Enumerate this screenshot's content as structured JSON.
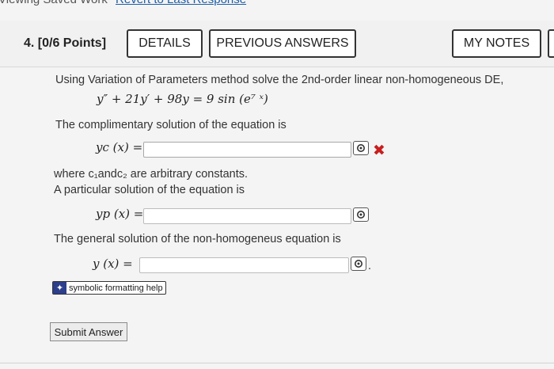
{
  "top_nav": {
    "viewing_text": "Viewing Saved Work",
    "revert_link": "Revert to Last Response"
  },
  "question": {
    "number_label": "4. [0/6 Points]",
    "details_label": "DETAILS",
    "previous_answers_label": "PREVIOUS ANSWERS",
    "my_notes_label": "MY NOTES"
  },
  "problem": {
    "intro": "Using Variation of Parameters method solve the 2nd-order linear non-homogeneous DE,",
    "equation": "y″ + 21y′ + 98y = 9 sin (e⁷ ˣ)",
    "complementary_prompt": "The complimentary solution of the equation is",
    "yc_label": "yc (x) =",
    "yc_value": "",
    "constants_note": "where c₁andc₂ are arbitrary constants.",
    "particular_prompt": "A particular solution of the equation is",
    "yp_label": "yp (x) =",
    "yp_value": "",
    "general_prompt": "The general solution of the non-homogeneus equation is",
    "y_label": "y (x) =",
    "y_value": "",
    "period": "."
  },
  "status": {
    "yc_incorrect": "✖"
  },
  "help": {
    "label": "symbolic formatting help"
  },
  "actions": {
    "submit_label": "Submit Answer"
  },
  "colors": {
    "error": "#c81e1e",
    "help_badge": "#2d3e8c"
  }
}
